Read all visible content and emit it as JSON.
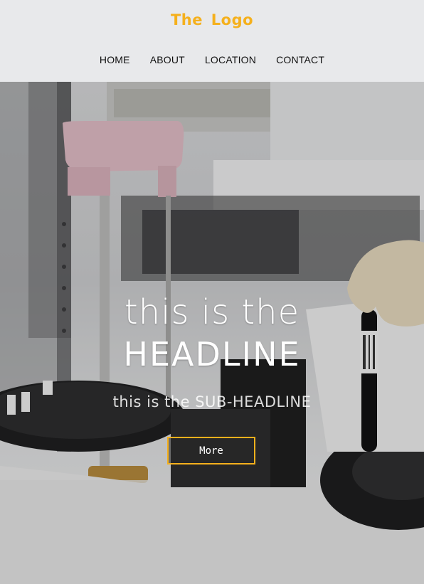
{
  "header": {
    "logo": "The  Logo",
    "nav": [
      {
        "label": "HOME"
      },
      {
        "label": "ABOUT"
      },
      {
        "label": "LOCATION"
      },
      {
        "label": "CONTACT"
      }
    ]
  },
  "hero": {
    "headline_line1": "this is the",
    "headline_line2": "HEADLINE",
    "subheadline": "this is the SUB-HEADLINE",
    "button_label": "More"
  },
  "colors": {
    "accent": "#f5b01c",
    "header_bg": "#e8e9eb",
    "nav_text": "#111111"
  }
}
